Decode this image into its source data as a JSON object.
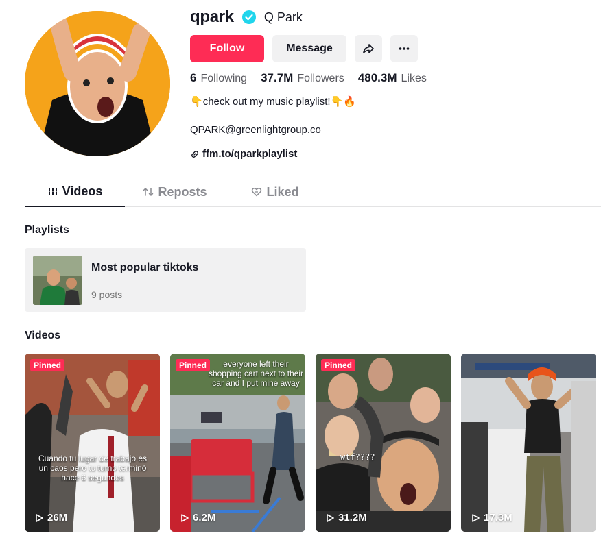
{
  "profile": {
    "username": "qpark",
    "nickname": "Q Park",
    "verified_icon": "verified-badge-icon",
    "follow_label": "Follow",
    "message_label": "Message",
    "share_icon": "share-icon",
    "more_icon": "more-icon",
    "stats": [
      {
        "value": "6",
        "label": "Following"
      },
      {
        "value": "37.7M",
        "label": "Followers"
      },
      {
        "value": "480.3M",
        "label": "Likes"
      }
    ],
    "bio": "check out my music playlist!",
    "email": "QPARK@greenlightgroup.co",
    "link": "ffm.to/qparkplaylist"
  },
  "tabs": [
    {
      "label": "Videos",
      "icon": "grid-icon"
    },
    {
      "label": "Reposts",
      "icon": "repost-icon"
    },
    {
      "label": "Liked",
      "icon": "heart-icon"
    }
  ],
  "playlists": {
    "title": "Playlists",
    "items": [
      {
        "name": "Most popular tiktoks",
        "count": "9 posts"
      }
    ]
  },
  "videos": {
    "title": "Videos",
    "items": [
      {
        "pinned": "Pinned",
        "views": "26M",
        "caption": "Cuando tu lugar de trabajo es un caos pero tu turno terminó hace 6 segundos"
      },
      {
        "pinned": "Pinned",
        "views": "6.2M",
        "caption": "everyone left their shopping cart next to their car and I put mine away"
      },
      {
        "pinned": "Pinned",
        "views": "31.2M",
        "caption": "wtf????"
      },
      {
        "pinned": "",
        "views": "17.3M",
        "caption": ""
      }
    ]
  },
  "colors": {
    "accent": "#fe2c55",
    "verified": "#20d5ec",
    "text": "#161823",
    "muted": "#8a8b91"
  }
}
